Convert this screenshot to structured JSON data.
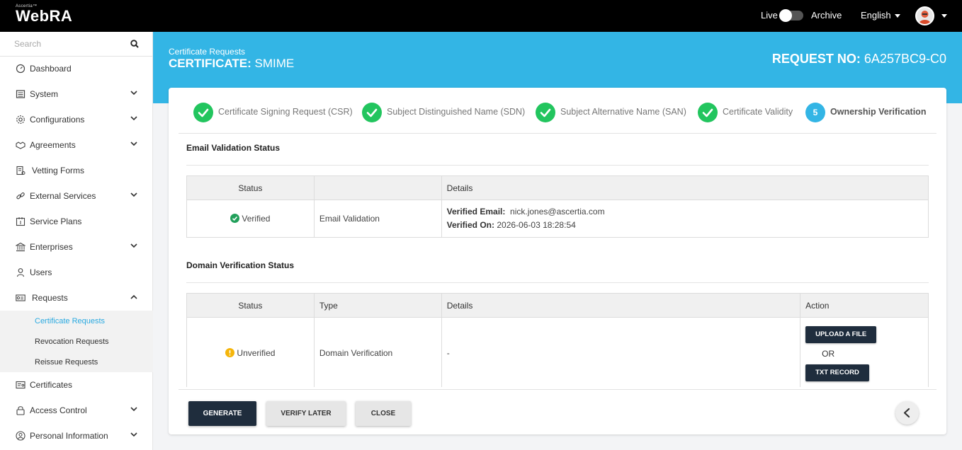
{
  "topbar": {
    "brand_small": "Ascertia™",
    "brand": "WebRA",
    "live_label": "Live",
    "archive_label": "Archive",
    "language": "English"
  },
  "sidebar": {
    "search_placeholder": "Search",
    "items": [
      {
        "label": "Dashboard",
        "icon": "dashboard-icon",
        "expandable": false
      },
      {
        "label": "System",
        "icon": "system-icon",
        "expandable": true
      },
      {
        "label": "Configurations",
        "icon": "gear-icon",
        "expandable": true
      },
      {
        "label": "Agreements",
        "icon": "handshake-icon",
        "expandable": true
      },
      {
        "label": "Vetting Forms",
        "icon": "form-icon",
        "expandable": false
      },
      {
        "label": "External Services",
        "icon": "link-icon",
        "expandable": true
      },
      {
        "label": "Service Plans",
        "icon": "plan-icon",
        "expandable": false
      },
      {
        "label": "Enterprises",
        "icon": "bank-icon",
        "expandable": true
      },
      {
        "label": "Users",
        "icon": "user-icon",
        "expandable": false
      },
      {
        "label": "Requests",
        "icon": "requests-icon",
        "expandable": true,
        "expanded": true
      },
      {
        "label": "Certificates",
        "icon": "certificate-icon",
        "expandable": false
      },
      {
        "label": "Access Control",
        "icon": "lock-icon",
        "expandable": true
      },
      {
        "label": "Personal Information",
        "icon": "person-icon",
        "expandable": true
      }
    ],
    "subitems": [
      {
        "label": "Certificate Requests",
        "active": true
      },
      {
        "label": "Revocation Requests",
        "active": false
      },
      {
        "label": "Reissue Requests",
        "active": false
      }
    ]
  },
  "header": {
    "breadcrumb": "Certificate Requests",
    "title_prefix": "CERTIFICATE:",
    "title_value": "SMIME",
    "request_prefix": "REQUEST NO:",
    "request_value": "6A257BC9-C0"
  },
  "steps": [
    {
      "label": "Certificate Signing Request (CSR)",
      "state": "done"
    },
    {
      "label": "Subject Distinguished Name (SDN)",
      "state": "done"
    },
    {
      "label": "Subject Alternative Name (SAN)",
      "state": "done"
    },
    {
      "label": "Certificate Validity",
      "state": "done"
    },
    {
      "label": "Ownership Verification",
      "state": "active",
      "number": "5"
    }
  ],
  "email_section": {
    "title": "Email Validation Status",
    "headers": [
      "Status",
      "",
      "Details"
    ],
    "status": "Verified",
    "type": "Email Validation",
    "email_label": "Verified Email:",
    "email_value": "nick.jones@ascertia.com",
    "on_label": "Verified On:",
    "on_value": "2026-06-03 18:28:54"
  },
  "domain_section": {
    "title": "Domain Verification Status",
    "headers": [
      "Status",
      "Type",
      "Details",
      "Action"
    ],
    "status": "Unverified",
    "type": "Domain Verification",
    "details": "-",
    "upload_label": "UPLOAD A FILE",
    "or_label": "OR",
    "txt_label": "TXT RECORD"
  },
  "footer": {
    "generate_label": "GENERATE",
    "verify_later_label": "VERIFY LATER",
    "close_label": "CLOSE"
  },
  "colors": {
    "accent": "#33b5e5",
    "success": "#22c55e",
    "warning": "#f5b50a",
    "dark_button": "#1f2d3d"
  }
}
